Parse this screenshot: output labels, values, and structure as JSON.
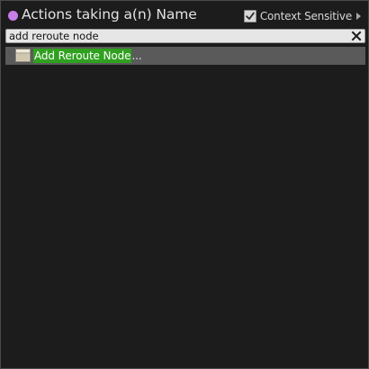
{
  "header": {
    "title": "Actions taking a(n) Name",
    "pin_color": "#c77ee8",
    "context_sensitive": {
      "label": "Context Sensitive",
      "checked": true
    }
  },
  "search": {
    "value": "add reroute node",
    "placeholder": "",
    "clear_icon": "close-icon"
  },
  "results": [
    {
      "label": "Add Reroute Node",
      "suffix": "...",
      "icon": "node-icon",
      "highlight_color": "#2fa01f",
      "selected": true
    }
  ],
  "colors": {
    "background": "#1c1c1c",
    "selected_row": "#5a5a5a",
    "search_bg": "#e6e6e6"
  }
}
